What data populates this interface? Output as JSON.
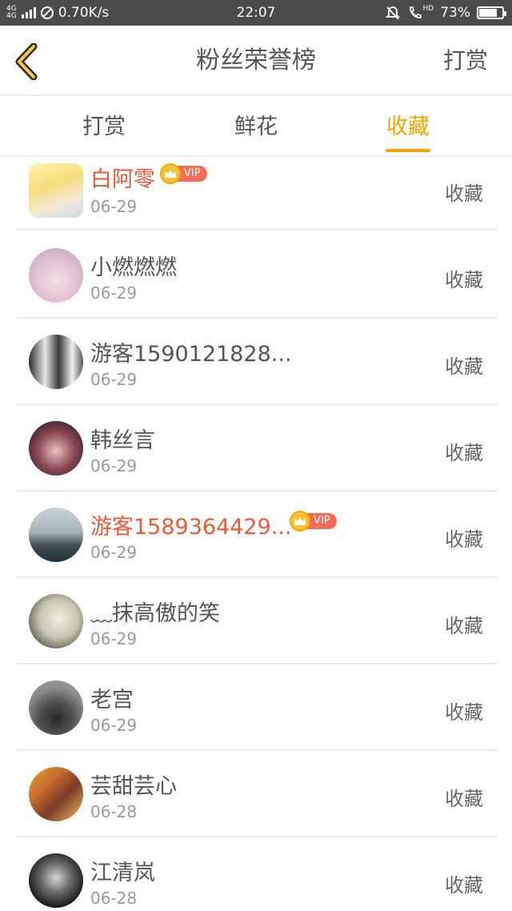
{
  "status_bar": {
    "network_label": "4G",
    "speed": "0.70K/s",
    "time": "22:07",
    "hd_label": "HD",
    "battery": "73%",
    "battery_level": 0.73
  },
  "header": {
    "title": "粉丝荣誉榜",
    "action_label": "打赏",
    "back_icon": "chevron-left-icon"
  },
  "tabs": [
    {
      "label": "打赏",
      "active": false
    },
    {
      "label": "鲜花",
      "active": false
    },
    {
      "label": "收藏",
      "active": true
    }
  ],
  "colors": {
    "accent": "#f5a300",
    "vip_name": "#ea5a3a",
    "vip_tag": "#f46b57"
  },
  "rows": [
    {
      "name": "白阿零",
      "date": "06-29",
      "action": "收藏",
      "vip": true,
      "vip_label": "VIP"
    },
    {
      "name": "小燃燃燃",
      "date": "06-29",
      "action": "收藏",
      "vip": false
    },
    {
      "name": "游客1590121828...",
      "date": "06-29",
      "action": "收藏",
      "vip": false
    },
    {
      "name": "韩丝言",
      "date": "06-29",
      "action": "收藏",
      "vip": false
    },
    {
      "name": "游客1589364429...",
      "date": "06-29",
      "action": "收藏",
      "vip": true,
      "vip_label": "VIP"
    },
    {
      "name": "﹏抹高傲的笑",
      "date": "06-29",
      "action": "收藏",
      "vip": false
    },
    {
      "name": "老宫",
      "date": "06-29",
      "action": "收藏",
      "vip": false
    },
    {
      "name": "芸甜芸心",
      "date": "06-28",
      "action": "收藏",
      "vip": false
    },
    {
      "name": "江清岚",
      "date": "06-28",
      "action": "收藏",
      "vip": false
    }
  ]
}
